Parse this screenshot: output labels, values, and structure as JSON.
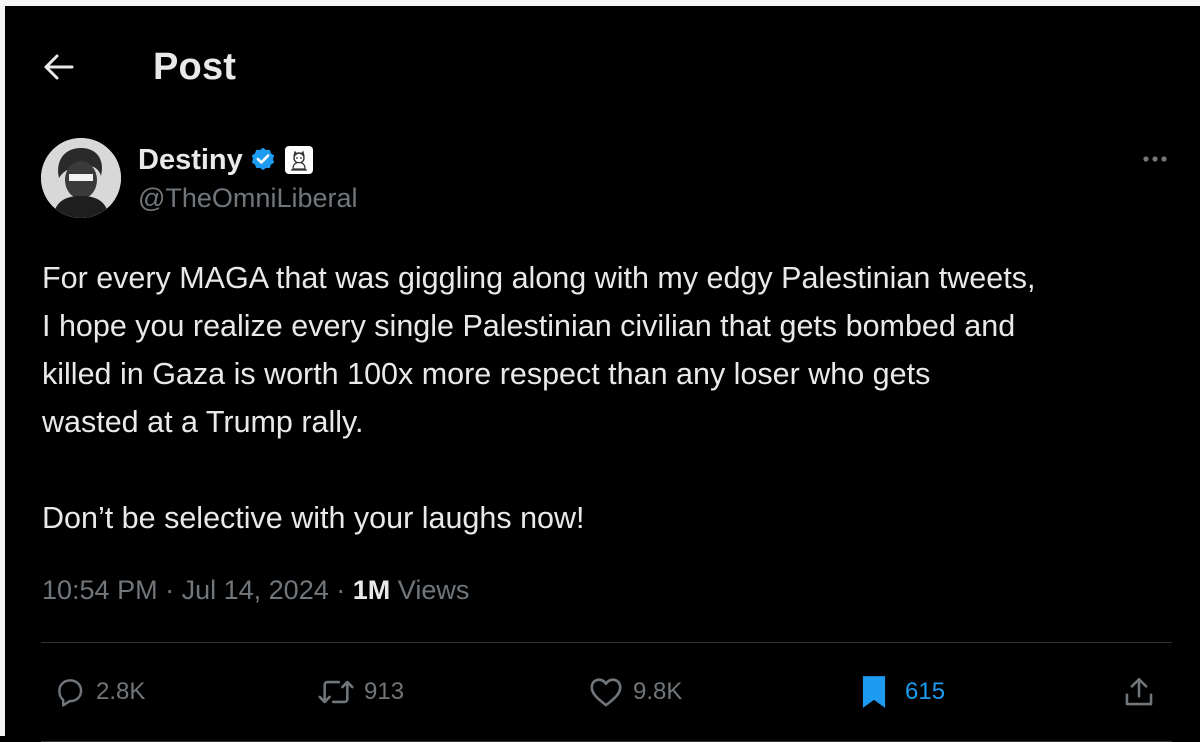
{
  "header": {
    "title": "Post"
  },
  "author": {
    "display_name": "Destiny",
    "handle": "@TheOmniLiberal",
    "verified": true
  },
  "tweet": {
    "paragraph_1": "For every MAGA that was giggling along with my edgy Palestinian tweets,\nI hope you realize every single Palestinian civilian that gets bombed and\nkilled in Gaza is worth 100x more respect than any loser who gets\nwasted at a Trump rally.",
    "paragraph_2": "Don’t be selective with your laughs now!"
  },
  "meta": {
    "time": "10:54 PM",
    "separator": "·",
    "date": "Jul 14, 2024",
    "views_count": "1M",
    "views_label": "Views"
  },
  "actions": {
    "replies": "2.8K",
    "reposts": "913",
    "likes": "9.8K",
    "bookmarks": "615"
  },
  "colors": {
    "background": "#000000",
    "primary_text": "#e7e9ea",
    "secondary_text": "#71767b",
    "accent": "#1d9bf0",
    "divider": "#2f3336"
  },
  "icons": {
    "back": "arrow-left-icon",
    "verified": "verified-badge-icon",
    "affiliate": "affiliate-badge-icon",
    "more": "ellipsis-icon",
    "reply": "reply-icon",
    "repost": "repost-icon",
    "like": "heart-icon",
    "bookmark": "bookmark-icon",
    "share": "share-icon"
  }
}
